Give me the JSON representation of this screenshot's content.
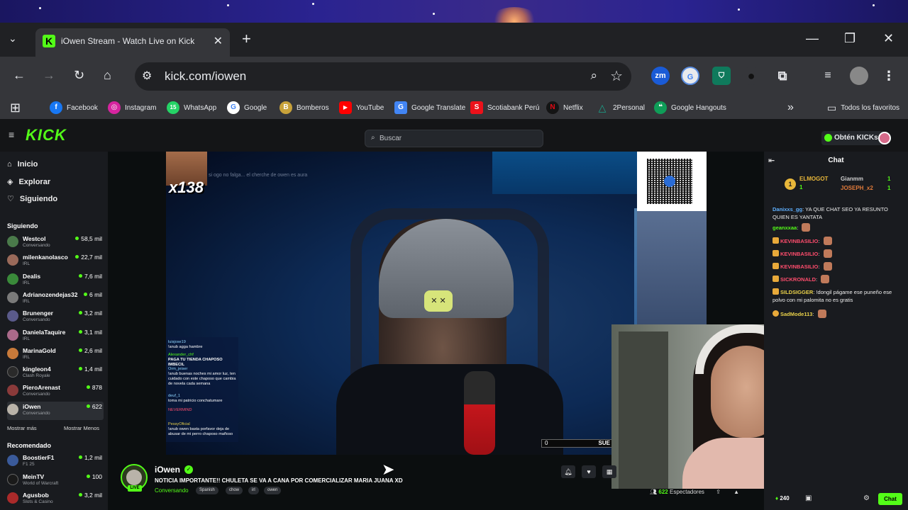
{
  "browser": {
    "tab_title": "iOwen Stream - Watch Live on Kick",
    "tab_favicon": "K",
    "url": "kick.com/iowen",
    "extensions": [
      "zm",
      "G",
      "shield",
      "spy",
      "puzzle"
    ],
    "bookmarks": [
      {
        "label": "Facebook",
        "icon": "f",
        "color": "#1877f2"
      },
      {
        "label": "Instagram",
        "icon": "◎",
        "color": "#d6249f"
      },
      {
        "label": "WhatsApp",
        "icon": "15",
        "color": "#25d366"
      },
      {
        "label": "Google",
        "icon": "G",
        "color": "#4285f4"
      },
      {
        "label": "Bomberos",
        "icon": "B",
        "color": "#c8a23a"
      },
      {
        "label": "YouTube",
        "icon": "▶",
        "color": "#ff0000"
      },
      {
        "label": "Google Translate",
        "icon": "G",
        "color": "#4285f4"
      },
      {
        "label": "Scotiabank Perú",
        "icon": "S",
        "color": "#ec111a"
      },
      {
        "label": "Netflix",
        "icon": "N",
        "color": "#e50914"
      },
      {
        "label": "2Personal",
        "icon": "△",
        "color": "#1aa38a"
      },
      {
        "label": "Google Hangouts",
        "icon": "❝",
        "color": "#0f9d58"
      }
    ],
    "bookmarks_folder": "Todos los favoritos"
  },
  "kick": {
    "logo": "KICK",
    "search_placeholder": "Buscar",
    "get_kicks": "Obtén KICKs"
  },
  "sidebar": {
    "nav": [
      {
        "label": "Inicio",
        "icon": "⌂"
      },
      {
        "label": "Explorar",
        "icon": "◈"
      },
      {
        "label": "Siguiendo",
        "icon": "♡"
      }
    ],
    "following_header": "Siguiendo",
    "following": [
      {
        "name": "Westcol",
        "category": "Conversando",
        "viewers": "58,5 mil",
        "color": "#4a7a4a"
      },
      {
        "name": "milenkanolasco",
        "category": "IRL",
        "viewers": "22,7 mil",
        "color": "#9a6a5a"
      },
      {
        "name": "Dealis",
        "category": "IRL",
        "viewers": "7,6 mil",
        "color": "#3a8a3a"
      },
      {
        "name": "Adrianozendejas32",
        "category": "IRL",
        "viewers": "6 mil",
        "color": "#7a7a7a"
      },
      {
        "name": "Brunenger",
        "category": "Conversando",
        "viewers": "3,2 mil",
        "color": "#5a5a8a"
      },
      {
        "name": "DanielaTaquire",
        "category": "IRL",
        "viewers": "3,1 mil",
        "color": "#aa6a8a"
      },
      {
        "name": "MarinaGold",
        "category": "IRL",
        "viewers": "2,6 mil",
        "color": "#c87a3a"
      },
      {
        "name": "kingleon4",
        "category": "Clash Royale",
        "viewers": "1,4 mil",
        "color": "#2a2a2a"
      },
      {
        "name": "PieroArenast",
        "category": "Conversando",
        "viewers": "878",
        "color": "#8a3a3a"
      },
      {
        "name": "iOwen",
        "category": "Conversando",
        "viewers": "622",
        "color": "#b9b3a9"
      }
    ],
    "show_more": "Mostrar más",
    "show_less": "Mostrar Menos",
    "recommended_header": "Recomendado",
    "recommended": [
      {
        "name": "BoostierF1",
        "category": "F1 25",
        "viewers": "1,2 mil",
        "color": "#3a5a9a"
      },
      {
        "name": "MeinTV",
        "category": "World of Warcraft",
        "viewers": "100",
        "color": "#1a1a1a"
      },
      {
        "name": "Agusbob",
        "category": "Slots & Casino",
        "viewers": "3,2 mil",
        "color": "#aa2a2a"
      }
    ]
  },
  "video": {
    "multiplier": "x138",
    "top_caption": "si ogo no falga... el cherche de owen es aura",
    "progress_value": "0",
    "progress_label": "SUE",
    "overlay_chat": [
      {
        "user": "luisjose19",
        "text": "!anub agga hambre"
      },
      {
        "user": "Alexander_chf",
        "text": "PAGA TU TIENDA CHAPOSO IMBECIL"
      },
      {
        "user": "Orm_jeiser",
        "text": "!anub buenas noches mi amor luz, ten cuidado con este chaposo que cambia de novela cada semana"
      },
      {
        "user": "deuf_1",
        "text": "toma mi patricio conchatumare"
      },
      {
        "user": "NEVERMIND",
        "text": ""
      },
      {
        "user": "PessyOficial",
        "text": "!anub owen basta porfavor deja de abusar de mi perro chaposo mañoso"
      }
    ]
  },
  "stream": {
    "streamer": "iOwen",
    "live_label": "LIVE",
    "title": "NOTICIA IMPORTANTE!! CHULETA SE VA A CANA POR COMERCIALIZAR MARIA JUANA XD",
    "category": "Conversando",
    "tags": [
      "Spanish",
      "chow",
      "irl",
      "owen"
    ],
    "viewers": "622",
    "viewers_label": "Espectadores"
  },
  "chat": {
    "header": "Chat",
    "pinned": [
      {
        "name": "ELMOGOT",
        "count": "1",
        "color": "#e8b73a"
      },
      {
        "name": "Gianmm",
        "count": "1",
        "color": "#cfcfcf"
      },
      {
        "name": "JOSEPH_x2",
        "count": "1",
        "color": "#e07a3a"
      }
    ],
    "messages": [
      {
        "user": "Danixxs_gg",
        "text": "YA QUE CHAT SEO YA RESUNTO QUIEN ES YANTATA",
        "color": "#5fb0ff",
        "badge": false
      },
      {
        "user": "geanxxaa",
        "text": "",
        "color": "#53fc18",
        "badge": false,
        "emote": true
      },
      {
        "user": "KEVINBASILIO",
        "text": "",
        "color": "#ff4d6d",
        "badge": true,
        "emote": true
      },
      {
        "user": "KEVINBASILIO",
        "text": "",
        "color": "#ff4d6d",
        "badge": true,
        "emote": true
      },
      {
        "user": "KEVINBASILIO",
        "text": "",
        "color": "#ff4d6d",
        "badge": true,
        "emote": true
      },
      {
        "user": "SICKRONALD",
        "text": "",
        "color": "#ff4d6d",
        "badge": true,
        "emote": true
      },
      {
        "user": "SILDSIGGER",
        "text": "!dongil págame ese puneño ese polvo con mi palomita no es gratis",
        "color": "#e8d04a",
        "badge": true
      },
      {
        "user": "SadMode113",
        "text": "",
        "color": "#e8d04a",
        "badge": true,
        "emote": true
      }
    ],
    "kicks_count": "240",
    "send_button": "Chat"
  }
}
